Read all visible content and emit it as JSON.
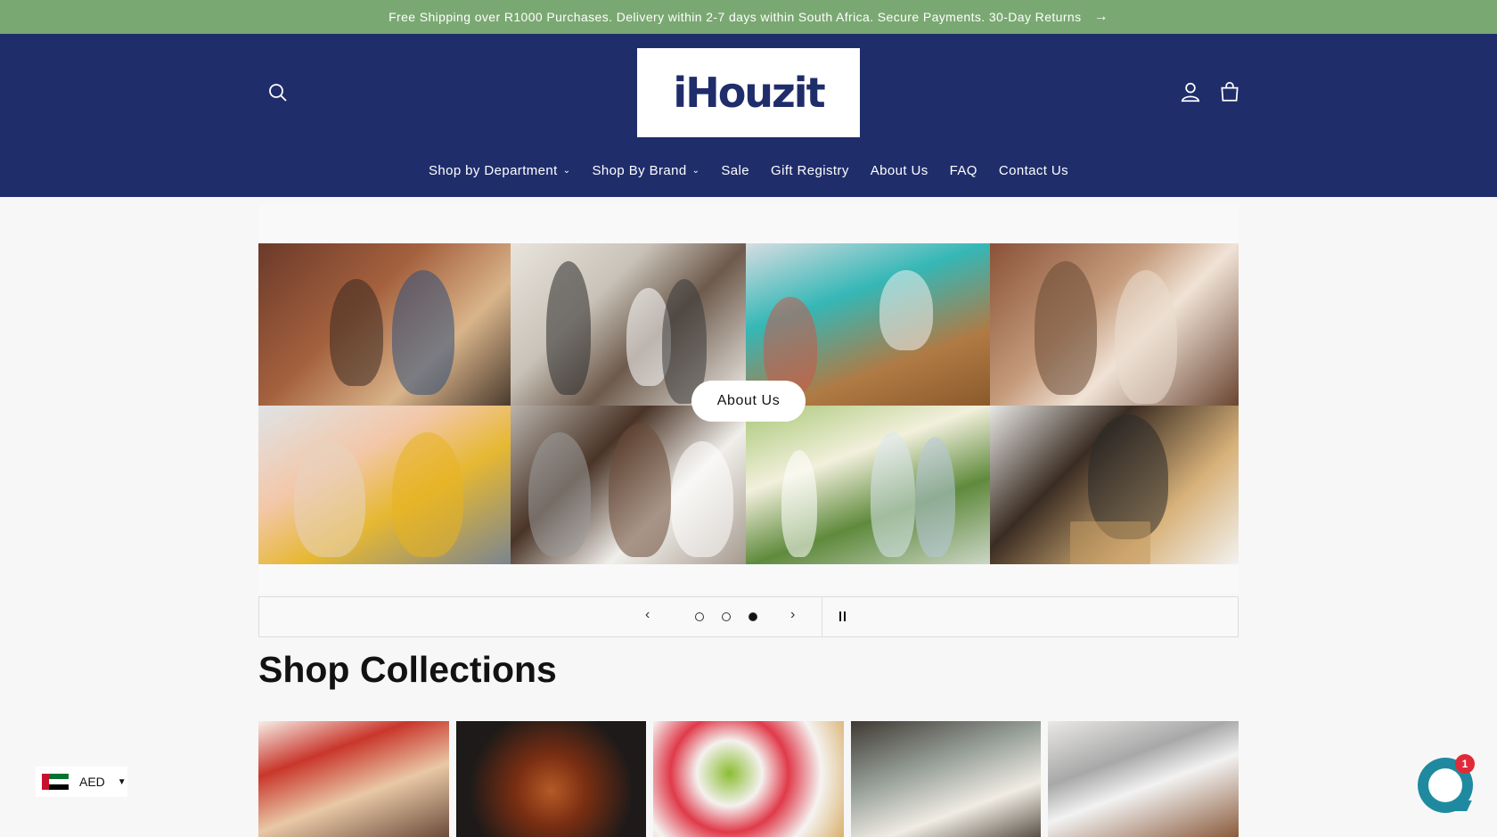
{
  "announcement": {
    "text": "Free Shipping over R1000 Purchases. Delivery within 2-7 days within South Africa. Secure Payments. 30-Day Returns",
    "arrow": "→"
  },
  "header": {
    "logo": "iHouzit",
    "icons": [
      "search-icon",
      "account-icon",
      "cart-icon"
    ],
    "colors": {
      "background": "#1f2d6b",
      "announcement": "#7aa872"
    }
  },
  "nav": {
    "items": [
      {
        "label": "Shop by Department",
        "dropdown": true
      },
      {
        "label": "Shop By Brand",
        "dropdown": true
      },
      {
        "label": "Sale"
      },
      {
        "label": "Gift Registry"
      },
      {
        "label": "About Us"
      },
      {
        "label": "FAQ"
      },
      {
        "label": "Contact Us"
      }
    ]
  },
  "hero": {
    "button_label": "About Us",
    "slides_total": 3,
    "active_slide": 3
  },
  "sections": {
    "shop_collections": "Shop Collections"
  },
  "currency": {
    "code": "AED",
    "flag": "uae-flag-icon"
  },
  "chat": {
    "badge_count": "1"
  }
}
